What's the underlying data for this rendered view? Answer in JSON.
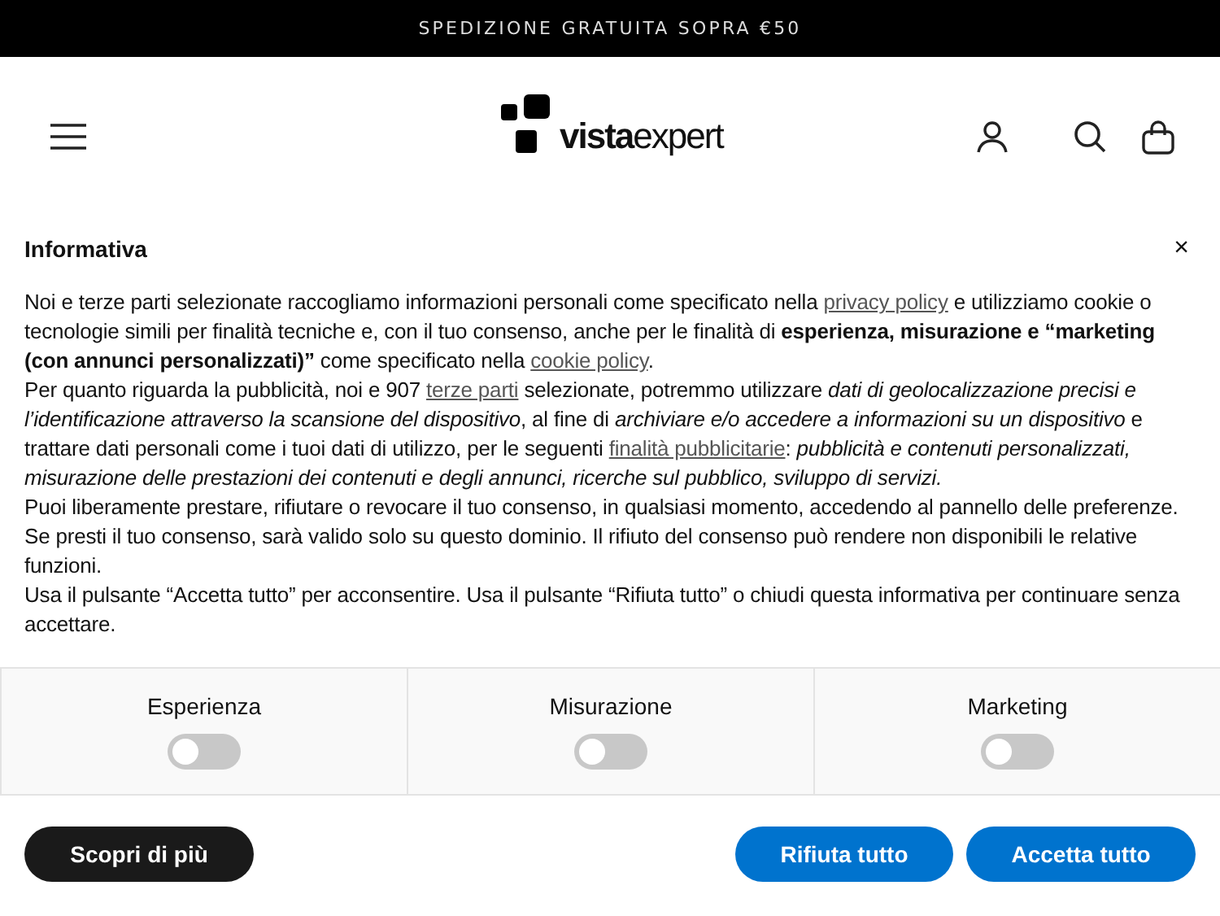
{
  "announcement": "SPEDIZIONE GRATUITA SOPRA €50",
  "header": {
    "logo": "**vista**expert"
  },
  "notice": {
    "title": "Informativa",
    "close": "×",
    "paragraphs": [
      [
        {
          "kind": "text",
          "text": "Noi e terze parti selezionate raccogliamo informazioni personali come specificato nella "
        },
        {
          "kind": "link",
          "text": "privacy policy"
        },
        {
          "kind": "text",
          "text": " e utilizziamo cookie o tecnologie simili per finalità tecniche e, con il tuo consenso, anche per le finalità di **esperienza, misurazione e “marketing (con annunci personalizzati)”** come specificato nella "
        },
        {
          "kind": "link",
          "text": "cookie policy"
        },
        {
          "kind": "text",
          "text": "."
        }
      ],
      [
        {
          "kind": "text",
          "text": "Per quanto riguarda la pubblicità, noi e 907 "
        },
        {
          "kind": "link",
          "text": "terze parti"
        },
        {
          "kind": "text",
          "text": " selezionate, potremmo utilizzare *dati di geolocalizzazione precisi e l’identificazione attraverso la scansione del dispositivo*, al fine di *archiviare e/o accedere a informazioni su un dispositivo* e trattare dati personali come i tuoi dati di utilizzo, per le seguenti "
        },
        {
          "kind": "link",
          "text": "finalità pubblicitarie"
        },
        {
          "kind": "text",
          "text": ": *pubblicità e contenuti personalizzati, misurazione delle prestazioni dei contenuti e degli annunci, ricerche sul pubblico, sviluppo di servizi.*"
        }
      ],
      [
        {
          "kind": "text",
          "text": "Puoi liberamente prestare, rifiutare o revocare il tuo consenso, in qualsiasi momento, accedendo al pannello delle preferenze. Se presti il tuo consenso, sarà valido solo su questo dominio. Il rifiuto del consenso può rendere non disponibili le relative funzioni."
        }
      ],
      [
        {
          "kind": "text",
          "text": "Usa il pulsante “Accetta tutto” per acconsentire. Usa il pulsante “Rifiuta tutto” o chiudi questa informativa per continuare senza accettare."
        }
      ]
    ],
    "toggles": [
      {
        "label": "Esperienza",
        "checked": false
      },
      {
        "label": "Misurazione",
        "checked": false
      },
      {
        "label": "Marketing",
        "checked": false
      }
    ],
    "buttons": [
      {
        "label": "Scopri di più",
        "kind": "dark"
      },
      {
        "label": "Rifiuta tutto",
        "kind": "primary"
      },
      {
        "label": "Accetta tutto",
        "kind": "primary"
      }
    ]
  }
}
